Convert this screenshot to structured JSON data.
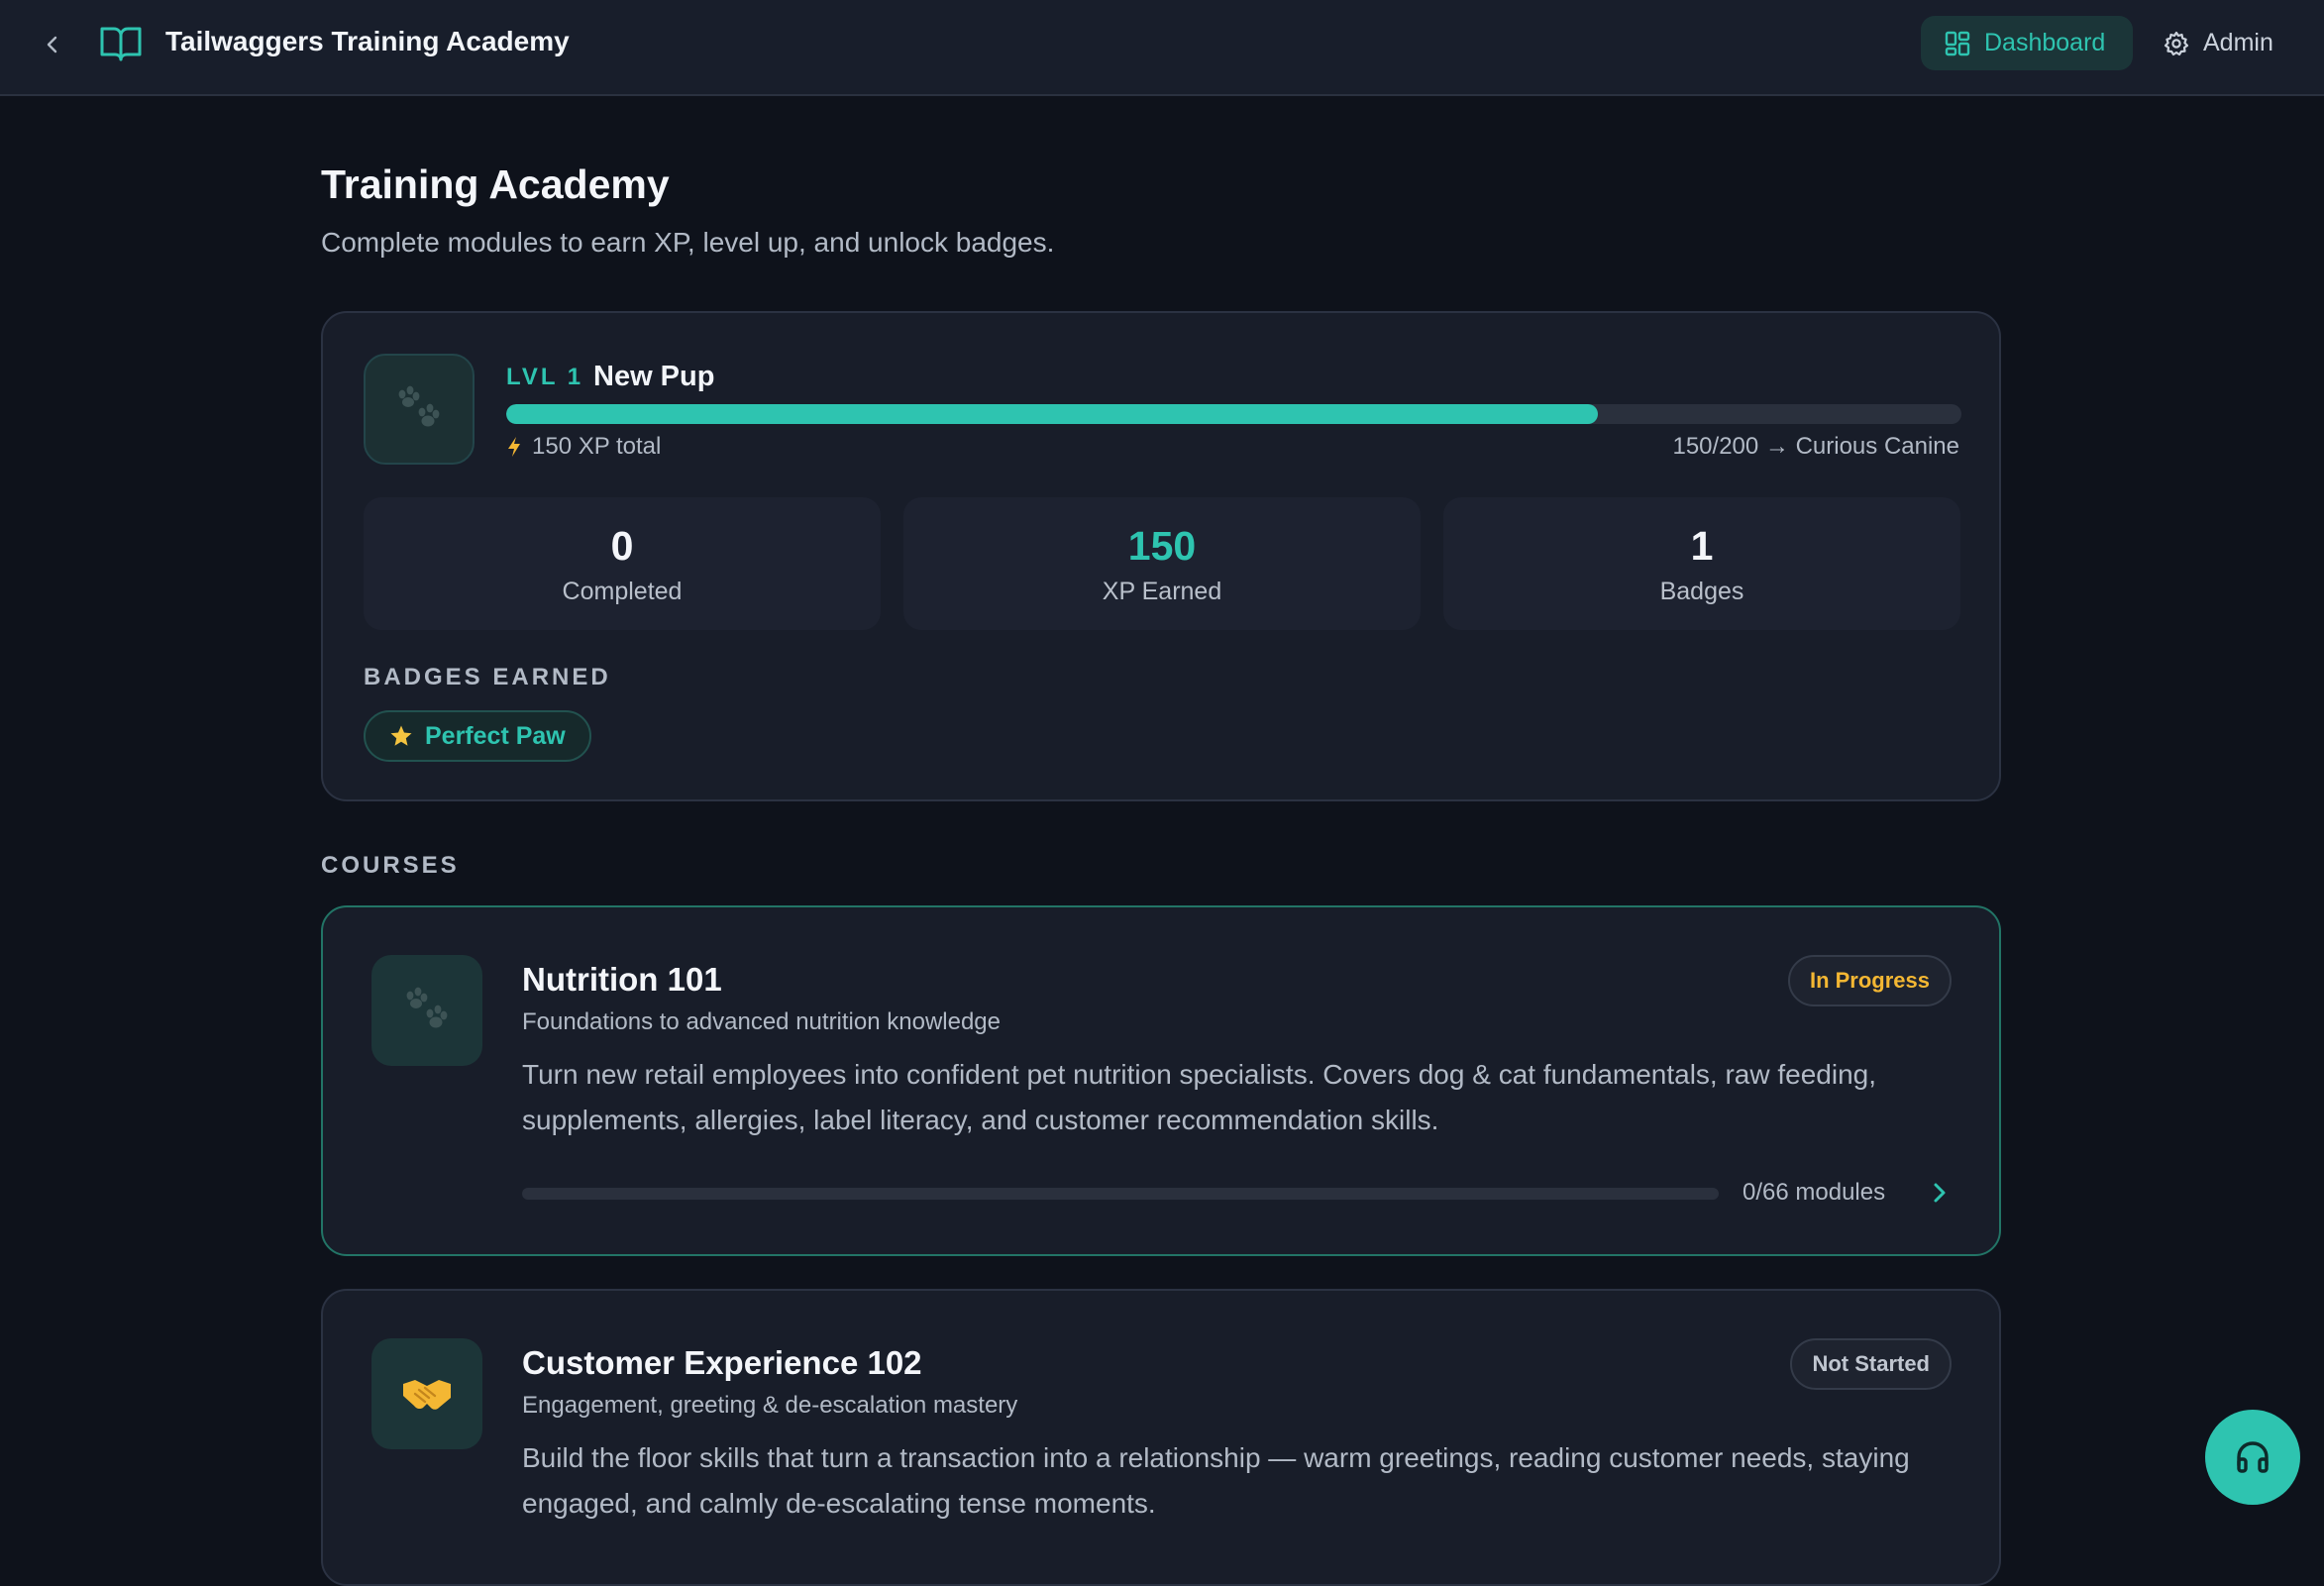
{
  "header": {
    "app_title": "Tailwaggers Training Academy",
    "nav_dashboard": "Dashboard",
    "nav_admin": "Admin"
  },
  "page": {
    "title": "Training Academy",
    "subtitle": "Complete modules to earn XP, level up, and unlock badges."
  },
  "profile": {
    "level_label": "LVL 1",
    "level_name": "New Pup",
    "xp_progress_fraction": 0.75,
    "xp_total": "150 XP total",
    "xp_next": "150/200 → Curious Canine",
    "stats": [
      {
        "value": "0",
        "label": "Completed"
      },
      {
        "value": "150",
        "label": "XP Earned"
      },
      {
        "value": "1",
        "label": "Badges"
      }
    ],
    "badges_heading": "BADGES EARNED",
    "badges": [
      {
        "label": "Perfect Paw"
      }
    ]
  },
  "courses_heading": "COURSES",
  "courses": [
    {
      "title": "Nutrition 101",
      "subtitle": "Foundations to advanced nutrition knowledge",
      "description": "Turn new retail employees into confident pet nutrition specialists. Covers dog & cat fundamentals, raw feeding, supplements, allergies, label literacy, and customer recommendation skills.",
      "status": "In Progress",
      "modules": "0/66 modules",
      "progress_fraction": 0,
      "icon": "paw-prints-icon"
    },
    {
      "title": "Customer Experience 102",
      "subtitle": "Engagement, greeting & de-escalation mastery",
      "description": "Build the floor skills that turn a transaction into a relationship — warm greetings, reading customer needs, staying engaged, and calmly de-escalating tense moments.",
      "status": "Not Started",
      "icon": "handshake-icon"
    }
  ],
  "colors": {
    "accent": "#2ec4b0",
    "background": "#0e121b",
    "card": "#181d29",
    "in_progress": "#f4b733"
  }
}
